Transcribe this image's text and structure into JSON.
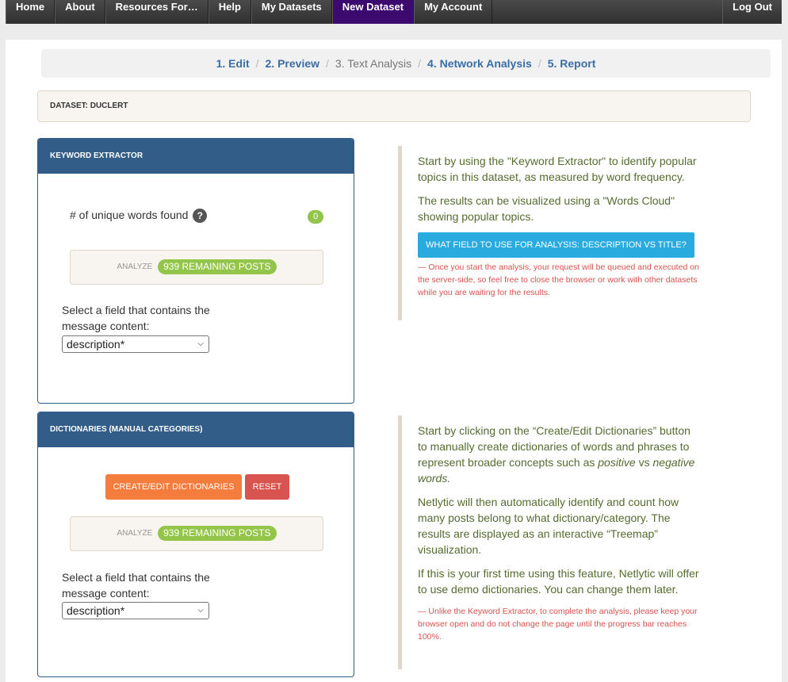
{
  "nav": {
    "items": [
      "Home",
      "About",
      "Resources For…",
      "Help",
      "My Datasets",
      "New Dataset",
      "My Account"
    ],
    "logout": "Log Out"
  },
  "steps": {
    "edit": "1. Edit",
    "preview": "2. Preview",
    "text": "3. Text Analysis",
    "network": "4. Network Analysis",
    "report": "5. Report"
  },
  "dataset_label": "DATASET: DUCLERT",
  "keyword": {
    "header": "KEYWORD EXTRACTOR",
    "unique_label": "# of unique words found",
    "help_icon_glyph": "?",
    "unique_count": "0",
    "analyze_label": "ANALYZE",
    "remaining": "939 REMAINING POSTS",
    "field_label": "Select a field that contains the message content:",
    "field_value": "description*"
  },
  "dictionaries": {
    "header": "DICTIONARIES (MANUAL CATEGORIES)",
    "create_label": "CREATE/EDIT DICTIONARIES",
    "reset_label": "RESET",
    "analyze_label": "ANALYZE",
    "remaining": "939 REMAINING POSTS",
    "field_label": "Select a field that contains the message content:",
    "field_value": "description*"
  },
  "info1": {
    "p1": "Start by using the \"Keyword Extractor\" to identify popular topics in this dataset, as measured by word frequency.",
    "p2": "The results can be visualized using a \"Words Cloud\" showing popular topics.",
    "button": "WHAT FIELD TO USE FOR ANALYSIS: DESCRIPTION VS TITLE?",
    "note": "— Once you start the analysis, your request will be queued and executed on the server-side, so feel free to close the browser or work with other datasets while you are waiting for the results."
  },
  "info2": {
    "p1a": "Start by clicking on the “Create/Edit Dictionaries” button to manually create dictionaries of words and phrases to represent broader concepts such as",
    "p1_pos": "positive",
    "p1_vs": "vs",
    "p1_neg": "negative words.",
    "p2": "Netlytic will then automatically identify and count how many posts belong to what dictionary/category. The results are displayed as an interactive “Treemap” visualization.",
    "p3": "If this is your first time using this feature, Netlytic will offer to use demo dictionaries. You can change them later.",
    "note": "— Unlike the Keyword Extractor, to complete the analysis, please keep your browser open and do not change the page until the progress bar reaches 100%."
  }
}
